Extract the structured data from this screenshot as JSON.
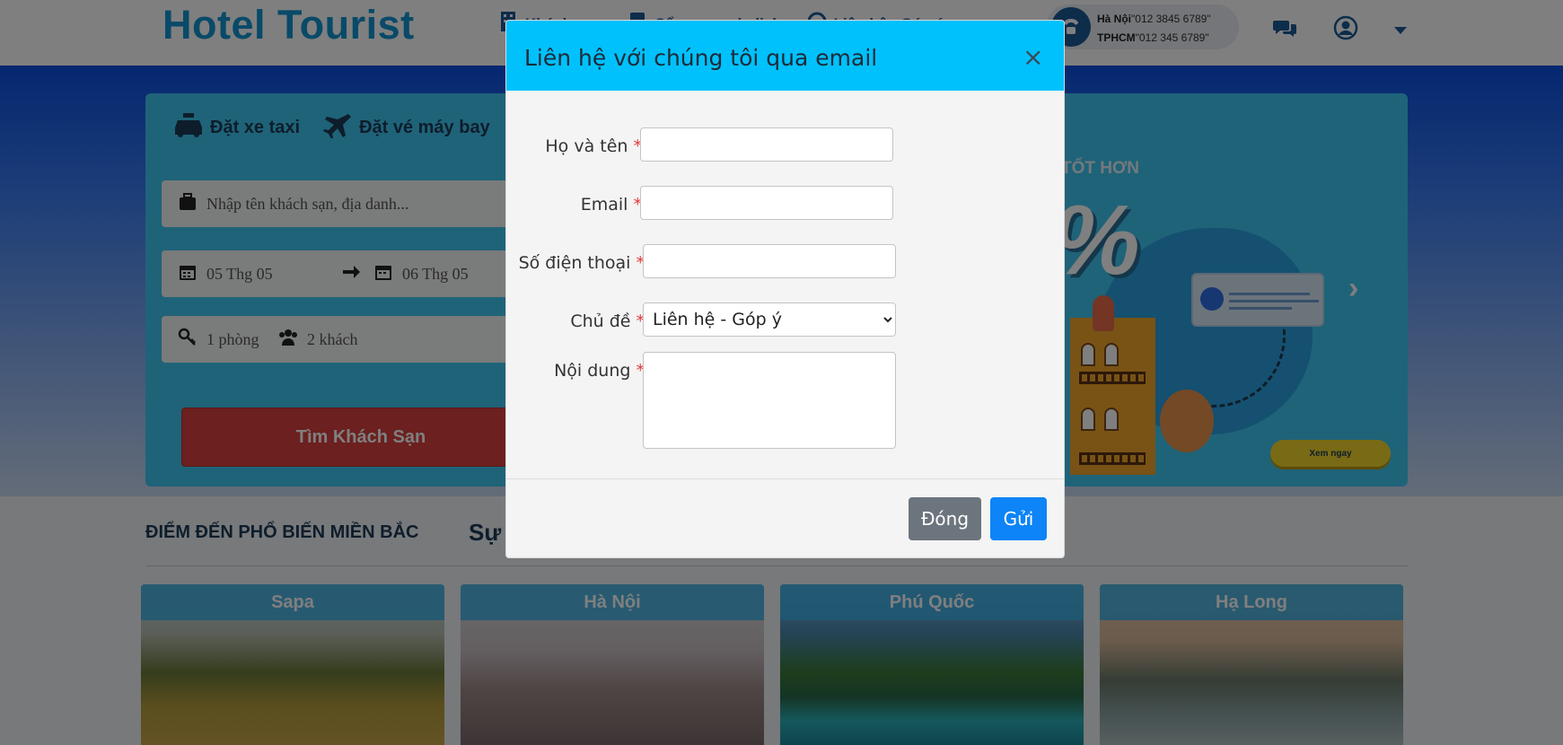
{
  "header": {
    "logo": "Hotel Tourist",
    "nav": [
      {
        "label": "Khách sạn",
        "icon": "building-icon"
      },
      {
        "label": "Cẩm nang du lịch",
        "icon": "book-icon"
      },
      {
        "label": "Liên hệ - Góp ý",
        "icon": "phone-icon"
      }
    ],
    "hotline": {
      "hanoi_label": "Hà Nội",
      "hanoi_phone": "\"012 3845 6789\"",
      "hcm_label": "TPHCM",
      "hcm_phone": "\"012 345 6789\""
    }
  },
  "search": {
    "tabs": [
      {
        "label": "Đặt xe taxi",
        "icon": "taxi-icon"
      },
      {
        "label": "Đặt vé máy bay",
        "icon": "airplane-icon"
      }
    ],
    "destination_placeholder": "Nhập tên khách sạn, địa danh...",
    "checkin": "05 Thg 05",
    "checkout": "06 Thg 05",
    "rooms": "1 phòng",
    "guests": "2 khách",
    "button": "Tìm Khách Sạn"
  },
  "promo": {
    "title": "TỐT HƠN",
    "percent": "%",
    "button": "Xem ngay"
  },
  "destinations": {
    "heading": "ĐIỂM ĐẾN PHỔ BIẾN MIỀN BẮC",
    "heading2": "Sự k",
    "cards": [
      "Sapa",
      "Hà Nội",
      "Phú Quốc",
      "Hạ Long"
    ]
  },
  "modal": {
    "title": "Liên hệ với chúng tôi qua email",
    "close_symbol": "×",
    "fields": {
      "name_label": "Họ và tên",
      "email_label": "Email",
      "phone_label": "Số điện thoại",
      "topic_label": "Chủ đề",
      "topic_value": "Liên hệ - Góp ý",
      "content_label": "Nội dung",
      "required_mark": "*"
    },
    "buttons": {
      "close": "Đóng",
      "send": "Gửi"
    }
  },
  "colors": {
    "modal_header": "#00c1fb",
    "send_button": "#0d84f7",
    "close_button": "#6c757d",
    "search_button": "#d9403e",
    "logo": "#1294d0"
  }
}
